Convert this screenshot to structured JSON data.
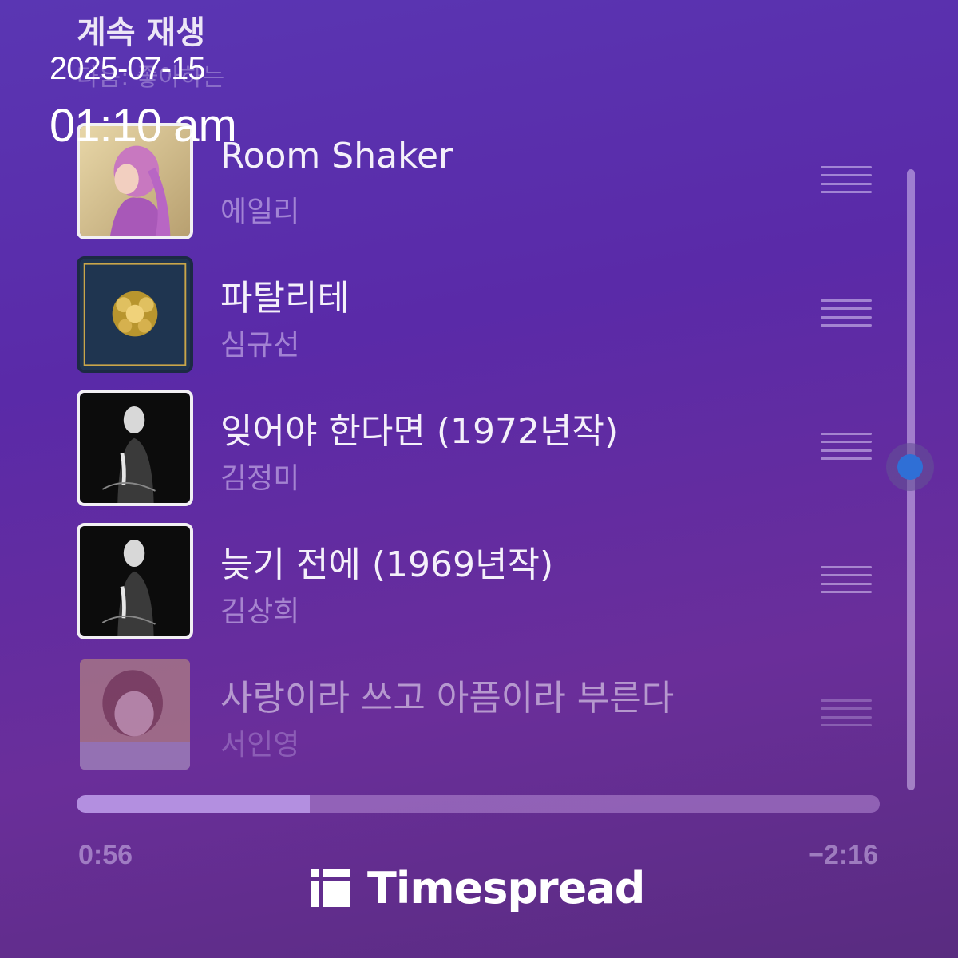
{
  "header": {
    "title": "계속 재생",
    "subtitle": "다음: 좋아하는"
  },
  "overlay": {
    "date": "2025-07-15",
    "time": "01:10 am"
  },
  "tracks": [
    {
      "title": "Room Shaker",
      "artist": "에일리",
      "cover": "pink-haired-portrait-cover"
    },
    {
      "title": "파탈리테",
      "artist": "심규선",
      "cover": "gold-floral-navy-cover"
    },
    {
      "title": "잊어야 한다면 (1972년작)",
      "artist": "김정미",
      "cover": "black-white-portrait-cover"
    },
    {
      "title": "늦기 전에 (1969년작)",
      "artist": "김상희",
      "cover": "black-white-portrait-cover"
    },
    {
      "title": "사랑이라 쓰고 아픔이라 부른다",
      "artist": "서인영",
      "cover": "soft-portrait-cover"
    }
  ],
  "playback": {
    "elapsed": "0:56",
    "remaining": "−2:16",
    "progress_fraction": 0.29
  },
  "queue_scroll_fraction": 0.48,
  "brand": {
    "name": "Timespread",
    "icon": "timespread-logo-icon"
  },
  "colors": {
    "background": "#5a2aa8",
    "progress_fill": "#b38fe0",
    "scroll_thumb": "#2f6fd6"
  }
}
